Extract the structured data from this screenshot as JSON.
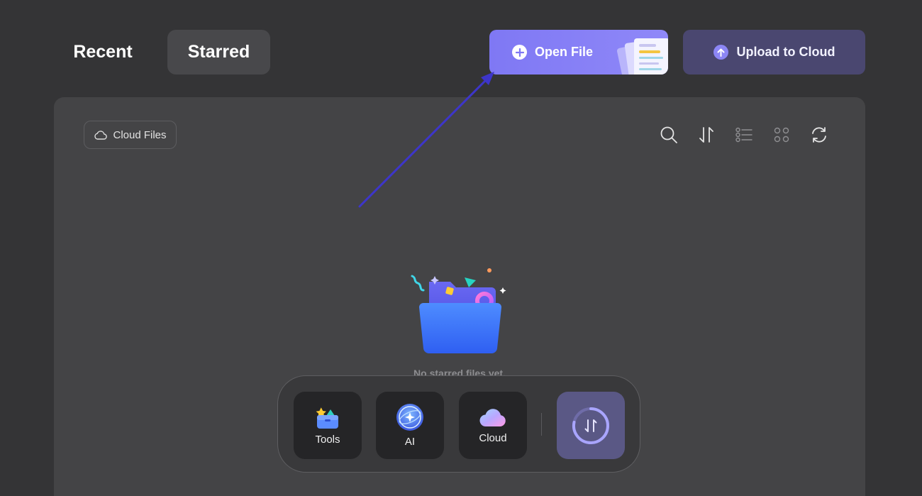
{
  "tabs": {
    "recent": "Recent",
    "starred": "Starred"
  },
  "actions": {
    "open_file": "Open File",
    "upload_to_cloud": "Upload to Cloud"
  },
  "panel": {
    "cloud_files_label": "Cloud Files",
    "toolbar_icons": [
      "search-icon",
      "sort-icon",
      "list-view-icon",
      "grid-view-icon",
      "refresh-icon"
    ],
    "empty_message": "No starred files yet."
  },
  "dock": {
    "tools_label": "Tools",
    "ai_label": "AI",
    "cloud_label": "Cloud"
  },
  "colors": {
    "background": "#343436",
    "panel": "#444446",
    "accent": "#8a83f7",
    "upload_button": "#4a4770",
    "annotation_arrow": "#3d35c9"
  }
}
